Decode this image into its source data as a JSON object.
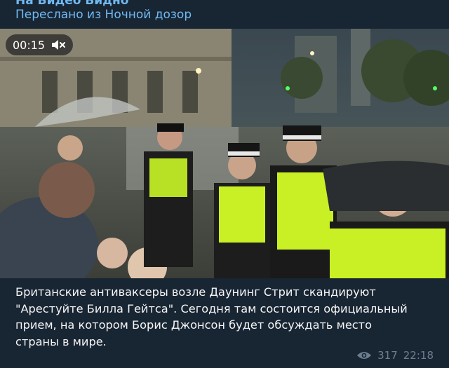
{
  "message": {
    "channel_name": "На Видео Видно",
    "forwarded_from": "Переслано из Ночной дозор",
    "video": {
      "time": "00:15",
      "mute_icon": "muted-speaker-icon",
      "overlay_color": "#282828"
    },
    "caption_lines": [
      "Британские антиваксеры возле Даунинг Стрит скандируют",
      "\"Арестуйте Билла Гейтса\". Сегодня там состоится официальный",
      "прием, на котором Борис Джонсон будет обсуждать место",
      "страны в мире."
    ],
    "views": "317",
    "views_icon": "eye-icon",
    "time": "22:18"
  },
  "colors": {
    "background": "#17212b",
    "bubble": "#182533",
    "link": "#71baf2",
    "meta": "#6d7f8f",
    "hi_vis": "#c8f025"
  }
}
